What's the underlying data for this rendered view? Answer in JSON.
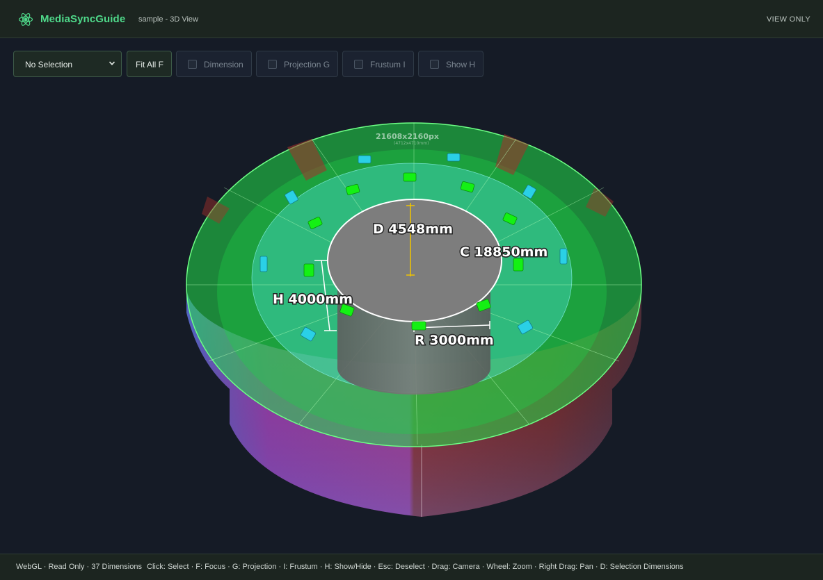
{
  "header": {
    "app_name": "MediaSyncGuide",
    "subtitle": "sample - 3D View",
    "mode": "VIEW ONLY",
    "logo_icon": "atom-icon",
    "accent_color": "#4fd98a"
  },
  "toolbar": {
    "selection": {
      "value": "No Selection",
      "icon": "chevron-down-icon"
    },
    "fit_label": "Fit All F",
    "toggles": [
      {
        "label": "Dimension",
        "checked": false
      },
      {
        "label": "Projection G",
        "checked": false
      },
      {
        "label": "Frustum I",
        "checked": false
      },
      {
        "label": "Show H",
        "checked": false
      }
    ]
  },
  "scene": {
    "screen_resolution": "21608x2160px",
    "screen_resolution_sub": "(4712x4710mm)",
    "dimensions": {
      "diameter": "D 4548mm",
      "circumference": "C 18850mm",
      "height": "H 4000mm",
      "radius": "R 3000mm"
    },
    "colors": {
      "screen_green": "#22e04a",
      "frustum_cyan": "#4ee6e6",
      "projector_green": "#14f014",
      "camera_cyan": "#2ad0e6",
      "wall_magenta": "#c2409e",
      "wall_red": "#a8302a",
      "cylinder_gray": "#7d7d7d"
    }
  },
  "statusbar": {
    "summary": "WebGL · Read Only · 37 Dimensions",
    "shortcuts": "Click: Select · F: Focus · G: Projection · I: Frustum · H: Show/Hide · Esc: Deselect · Drag: Camera · Wheel: Zoom · Right Drag: Pan · D: Selection Dimensions"
  }
}
